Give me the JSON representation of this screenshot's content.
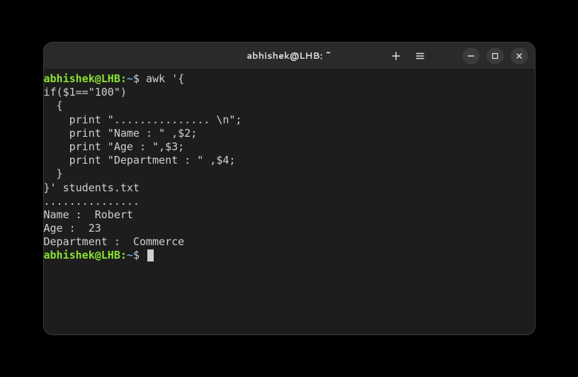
{
  "window": {
    "title": "abhishek@LHB: ~"
  },
  "titlebar": {
    "new_tab": "+",
    "menu": "≡",
    "minimize": "–",
    "maximize": "□",
    "close": "×"
  },
  "prompt": {
    "user_host": "abhishek@LHB",
    "sep": ":",
    "path": "~",
    "symbol": "$"
  },
  "session": {
    "command_lines": [
      "awk '{",
      "",
      "if($1==\"100\")",
      "",
      "  {",
      "    print \"............... \\n\";",
      "    print \"Name : \" ,$2;",
      "    print \"Age : \",$3;",
      "    print \"Department : \" ,$4;",
      "  }",
      "",
      "}' students.txt"
    ],
    "output_lines": [
      "............... ",
      "",
      "Name :  Robert",
      "Age :  23",
      "Department :  Commerce"
    ]
  }
}
